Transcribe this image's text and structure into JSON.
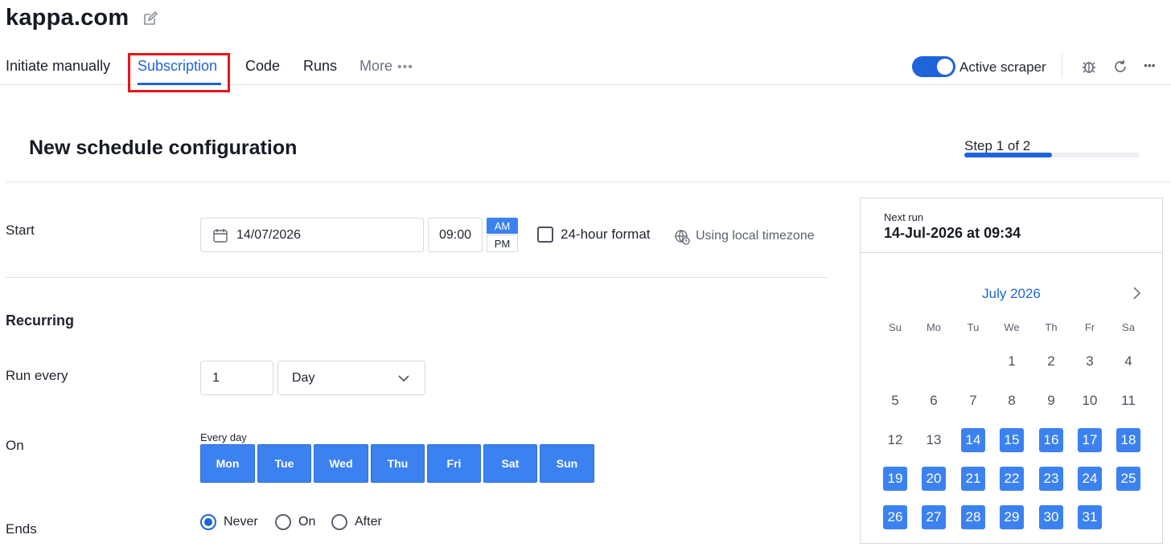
{
  "app": {
    "title": "kappa.com"
  },
  "tabs": [
    {
      "label": "Initiate manually"
    },
    {
      "label": "Subscription"
    },
    {
      "label": "Code"
    },
    {
      "label": "Runs"
    },
    {
      "label": "More",
      "dots": "•••"
    }
  ],
  "toolbar": {
    "toggle_label": "Active scraper",
    "toggle_on": true,
    "more_glyph": "•••"
  },
  "page": {
    "title": "New schedule configuration",
    "step_label": "Step 1 of 2",
    "step_progress": 0.5
  },
  "start": {
    "label": "Start",
    "date": "14/07/2026",
    "time": "09:00",
    "am": "AM",
    "pm": "PM",
    "format_label": "24-hour format",
    "timezone_label": "Using local timezone"
  },
  "recurring": {
    "label": "Recurring",
    "run_every_label": "Run every",
    "interval": "1",
    "unit": "Day",
    "on_label": "On",
    "every_day_label": "Every day",
    "days": [
      "Mon",
      "Tue",
      "Wed",
      "Thu",
      "Fri",
      "Sat",
      "Sun"
    ],
    "ends_label": "Ends",
    "ends_options": [
      "Never",
      "On",
      "After"
    ],
    "ends_selected": "Never"
  },
  "calendar": {
    "next_run_label": "Next run",
    "next_run_value": "14-Jul-2026 at 09:34",
    "month": "July 2026",
    "weekdays": [
      "Su",
      "Mo",
      "Tu",
      "We",
      "Th",
      "Fr",
      "Sa"
    ],
    "weeks": [
      [
        "",
        "",
        "",
        "1",
        "2",
        "3",
        "4"
      ],
      [
        "5",
        "6",
        "7",
        "8",
        "9",
        "10",
        "11"
      ],
      [
        "12",
        "13",
        "14",
        "15",
        "16",
        "17",
        "18"
      ],
      [
        "19",
        "20",
        "21",
        "22",
        "23",
        "24",
        "25"
      ],
      [
        "26",
        "27",
        "28",
        "29",
        "30",
        "31",
        ""
      ]
    ],
    "highlighted_from": 14
  },
  "colors": {
    "accent": "#1f64d8",
    "selected_day": "#3b82f0",
    "highlight_box": "#e8141b"
  }
}
